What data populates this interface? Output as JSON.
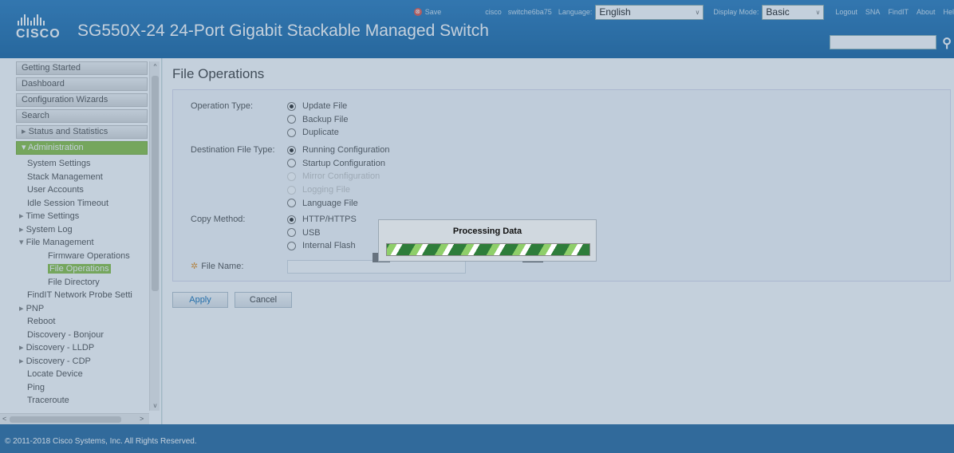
{
  "header": {
    "logo_text": "CISCO",
    "title": "SG550X-24 24-Port Gigabit Stackable Managed Switch",
    "save_label": "Save",
    "user": "cisco",
    "hostname": "switche6ba75",
    "language_label": "Language:",
    "language_value": "English",
    "display_mode_label": "Display Mode:",
    "display_mode_value": "Basic",
    "links": [
      "Logout",
      "SNA",
      "FindIT",
      "About",
      "Hel"
    ]
  },
  "sidebar": {
    "top_items": [
      "Getting Started",
      "Dashboard",
      "Configuration Wizards",
      "Search"
    ],
    "status_item": "Status and Statistics",
    "admin_item": "Administration",
    "admin_children": [
      {
        "label": "System Settings",
        "type": "leaf"
      },
      {
        "label": "Stack Management",
        "type": "leaf"
      },
      {
        "label": "User Accounts",
        "type": "leaf"
      },
      {
        "label": "Idle Session Timeout",
        "type": "leaf"
      },
      {
        "label": "Time Settings",
        "type": "collapsed"
      },
      {
        "label": "System Log",
        "type": "collapsed"
      },
      {
        "label": "File Management",
        "type": "open"
      },
      {
        "label": "Firmware Operations",
        "type": "child"
      },
      {
        "label": "File Operations",
        "type": "child-selected"
      },
      {
        "label": "File Directory",
        "type": "child"
      },
      {
        "label": "FindIT Network Probe Setti",
        "type": "leaf"
      },
      {
        "label": "PNP",
        "type": "collapsed"
      },
      {
        "label": "Reboot",
        "type": "leaf"
      },
      {
        "label": "Discovery - Bonjour",
        "type": "leaf"
      },
      {
        "label": "Discovery - LLDP",
        "type": "collapsed"
      },
      {
        "label": "Discovery - CDP",
        "type": "collapsed"
      },
      {
        "label": "Locate Device",
        "type": "leaf"
      },
      {
        "label": "Ping",
        "type": "leaf"
      },
      {
        "label": "Traceroute",
        "type": "leaf"
      }
    ]
  },
  "main": {
    "page_title": "File Operations",
    "operation_type": {
      "label": "Operation Type:",
      "options": [
        {
          "label": "Update File",
          "checked": true,
          "disabled": false
        },
        {
          "label": "Backup File",
          "checked": false,
          "disabled": false
        },
        {
          "label": "Duplicate",
          "checked": false,
          "disabled": false
        }
      ]
    },
    "destination_file_type": {
      "label": "Destination File Type:",
      "options": [
        {
          "label": "Running Configuration",
          "checked": true,
          "disabled": false
        },
        {
          "label": "Startup Configuration",
          "checked": false,
          "disabled": false
        },
        {
          "label": "Mirror Configuration",
          "checked": false,
          "disabled": true
        },
        {
          "label": "Logging File",
          "checked": false,
          "disabled": true
        },
        {
          "label": "Language File",
          "checked": false,
          "disabled": false
        }
      ]
    },
    "copy_method": {
      "label": "Copy Method:",
      "options": [
        {
          "label": "HTTP/HTTPS",
          "checked": true,
          "disabled": false
        },
        {
          "label": "USB",
          "checked": false,
          "disabled": false
        },
        {
          "label": "Internal Flash",
          "checked": false,
          "disabled": false
        }
      ]
    },
    "file_name": {
      "label": "File Name:",
      "value": ""
    },
    "apply_label": "Apply",
    "cancel_label": "Cancel"
  },
  "dialog": {
    "title": "Processing Data"
  },
  "footer": {
    "copyright": "© 2011-2018 Cisco Systems, Inc. All Rights Reserved."
  }
}
